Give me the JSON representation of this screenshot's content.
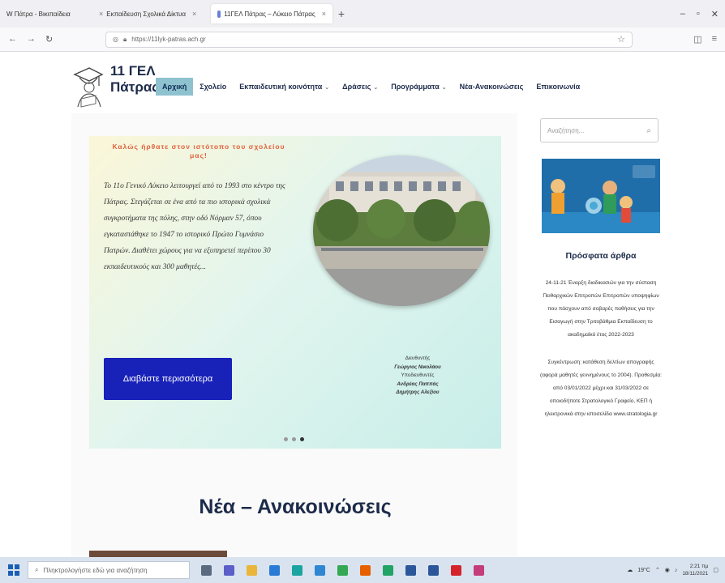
{
  "browser": {
    "tabs": [
      {
        "label": "W Πάτρα - Βικιπαίδεια",
        "active": false
      },
      {
        "label": "Εκπαίδευση Σχολικά Δίκτυα",
        "active": false
      },
      {
        "label": "11ΓΕΛ Πάτρας – Λύκειο Πάτρας",
        "active": true
      }
    ],
    "url": "https://11lyk-patras.ach.gr"
  },
  "site": {
    "brand_line1": "11 ΓΕΛ",
    "brand_line2": "Πάτρας",
    "menu": [
      {
        "label": "Αρχική",
        "active": true,
        "caret": false
      },
      {
        "label": "Σχολείο",
        "active": false,
        "caret": false
      },
      {
        "label": "Εκπαιδευτική κοινότητα",
        "active": false,
        "caret": true
      },
      {
        "label": "Δράσεις",
        "active": false,
        "caret": true
      },
      {
        "label": "Προγράμματα",
        "active": false,
        "caret": true
      },
      {
        "label": "Νέα-Ανακοινώσεις",
        "active": false,
        "caret": false
      },
      {
        "label": "Επικοινωνία",
        "active": false,
        "caret": false
      }
    ]
  },
  "hero": {
    "welcome": "Καλώς ήρθατε στον ιστότοπο του σχολείου μας!",
    "description": "Το 11ο Γενικό Λύκειο λειτουργεί από το 1993 στο κέντρο της Πάτρας. Στεγάζεται σε ένα από τα πιο ιστορικά σχολικά συγκροτήματα της πόλης, στην οδό Νόρμαν 57, όπου εγκαταστάθηκε το 1947 το ιστορικό Πρώτο Γυμνάσιο Πατρών. Διαθέτει χώρους για να εξυπηρετεί περίπου 30 εκπαιδευτικούς και 300 μαθητές...",
    "button_label": "Διαβάστε περισσότερα",
    "staff": [
      {
        "text": "Διευθυντής",
        "bold": false
      },
      {
        "text": "Γεώργιος Νικολάου",
        "bold": true
      },
      {
        "text": "Υποδιευθυντές",
        "bold": false
      },
      {
        "text": "Ανδρέας Παππάς",
        "bold": true
      },
      {
        "text": "Δημήτρης Αλεξίου",
        "bold": true
      }
    ],
    "slides_total": 3,
    "slide_active": 3
  },
  "news_title": "Νέα – Ανακοινώσεις",
  "sidebar": {
    "search_placeholder": "Αναζήτηση...",
    "recent_title": "Πρόσφατα άρθρα",
    "recent_items": [
      "24-11-21 Έναρξη διαδικασιών για την σύσταση Πειθαρχικών Επιτροπών Επιτροπών υποψηφίων που πάσχουν από σοβαρές παθήσεις για την Εισαγωγή στην Τριτοβάθμια Εκπαίδευση το ακαδημαϊκό έτος 2022-2023",
      "Συγκέντρωση: κατάθεση δελτίων απογραφής (αφορά μαθητές γεννημένους το 2004). Προθεσμία: από 03/01/2022 μέχρι και 31/03/2022 σε οποιοδήποτε Στρατολογικό Γραφείο, ΚΕΠ ή ηλεκτρονικά στην ιστοσελίδα www.stratologia.gr"
    ]
  },
  "taskbar": {
    "search_placeholder": "Πληκτρολογήστε εδώ για αναζήτηση",
    "weather": "19°C",
    "time": "2:21 πμ",
    "date": "18/11/2021"
  }
}
